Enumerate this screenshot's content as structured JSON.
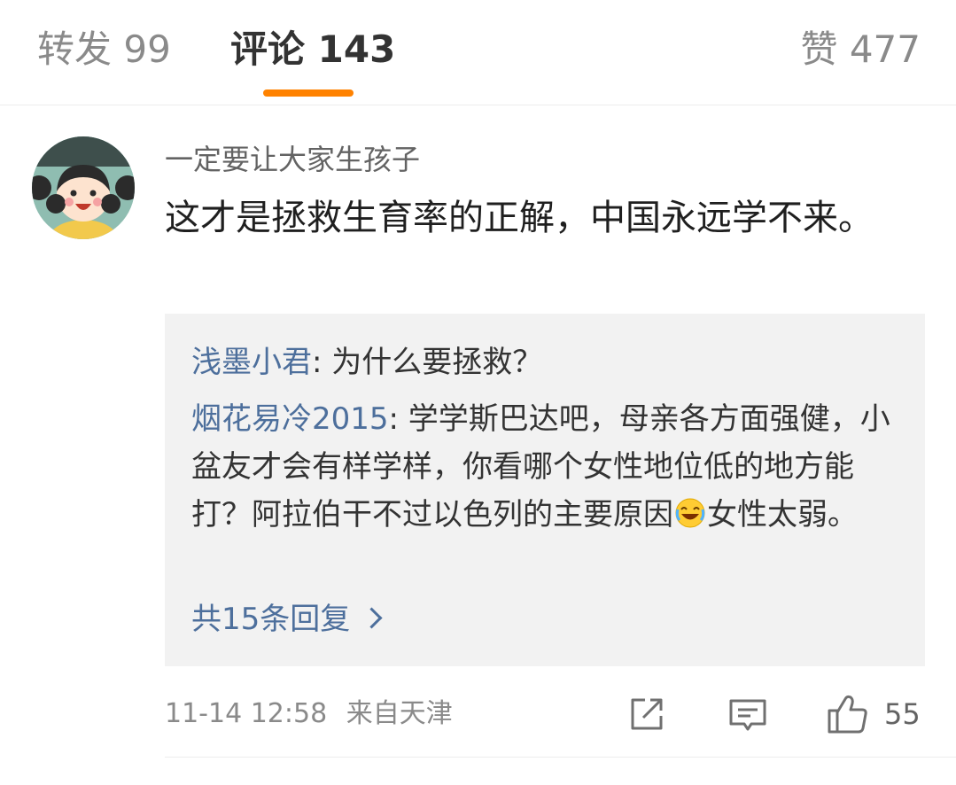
{
  "tabs": {
    "repost": "转发 99",
    "comments": "评论 143",
    "likes": "赞 477",
    "active": "comments",
    "accent_color": "#ff8200"
  },
  "comment": {
    "avatar_icon": "cartoon-girl-avatar",
    "username": "一定要让大家生孩子",
    "content": "这才是拯救生育率的正解，中国永远学不来。",
    "replies": [
      {
        "author": "浅墨小君",
        "separator": ": ",
        "text": "为什么要拯救？"
      },
      {
        "author": "烟花易冷2015",
        "separator": ": ",
        "text_before_emoji": "学学斯巴达吧，母亲各方面强健，小盆友才会有样学样，你看哪个女性地位低的地方能打？阿拉伯干不过以色列的主要原因",
        "emoji": "laughing-crying-emoji",
        "text_after_emoji": "女性太弱。"
      }
    ],
    "more_replies": "共15条回复",
    "timestamp": "11-14 12:58",
    "location": "来自天津",
    "actions": {
      "share_icon": "share-icon",
      "comment_icon": "comment-icon",
      "like_icon": "thumbs-up-icon",
      "like_count": "55"
    },
    "link_color": "#4d6f9c"
  }
}
